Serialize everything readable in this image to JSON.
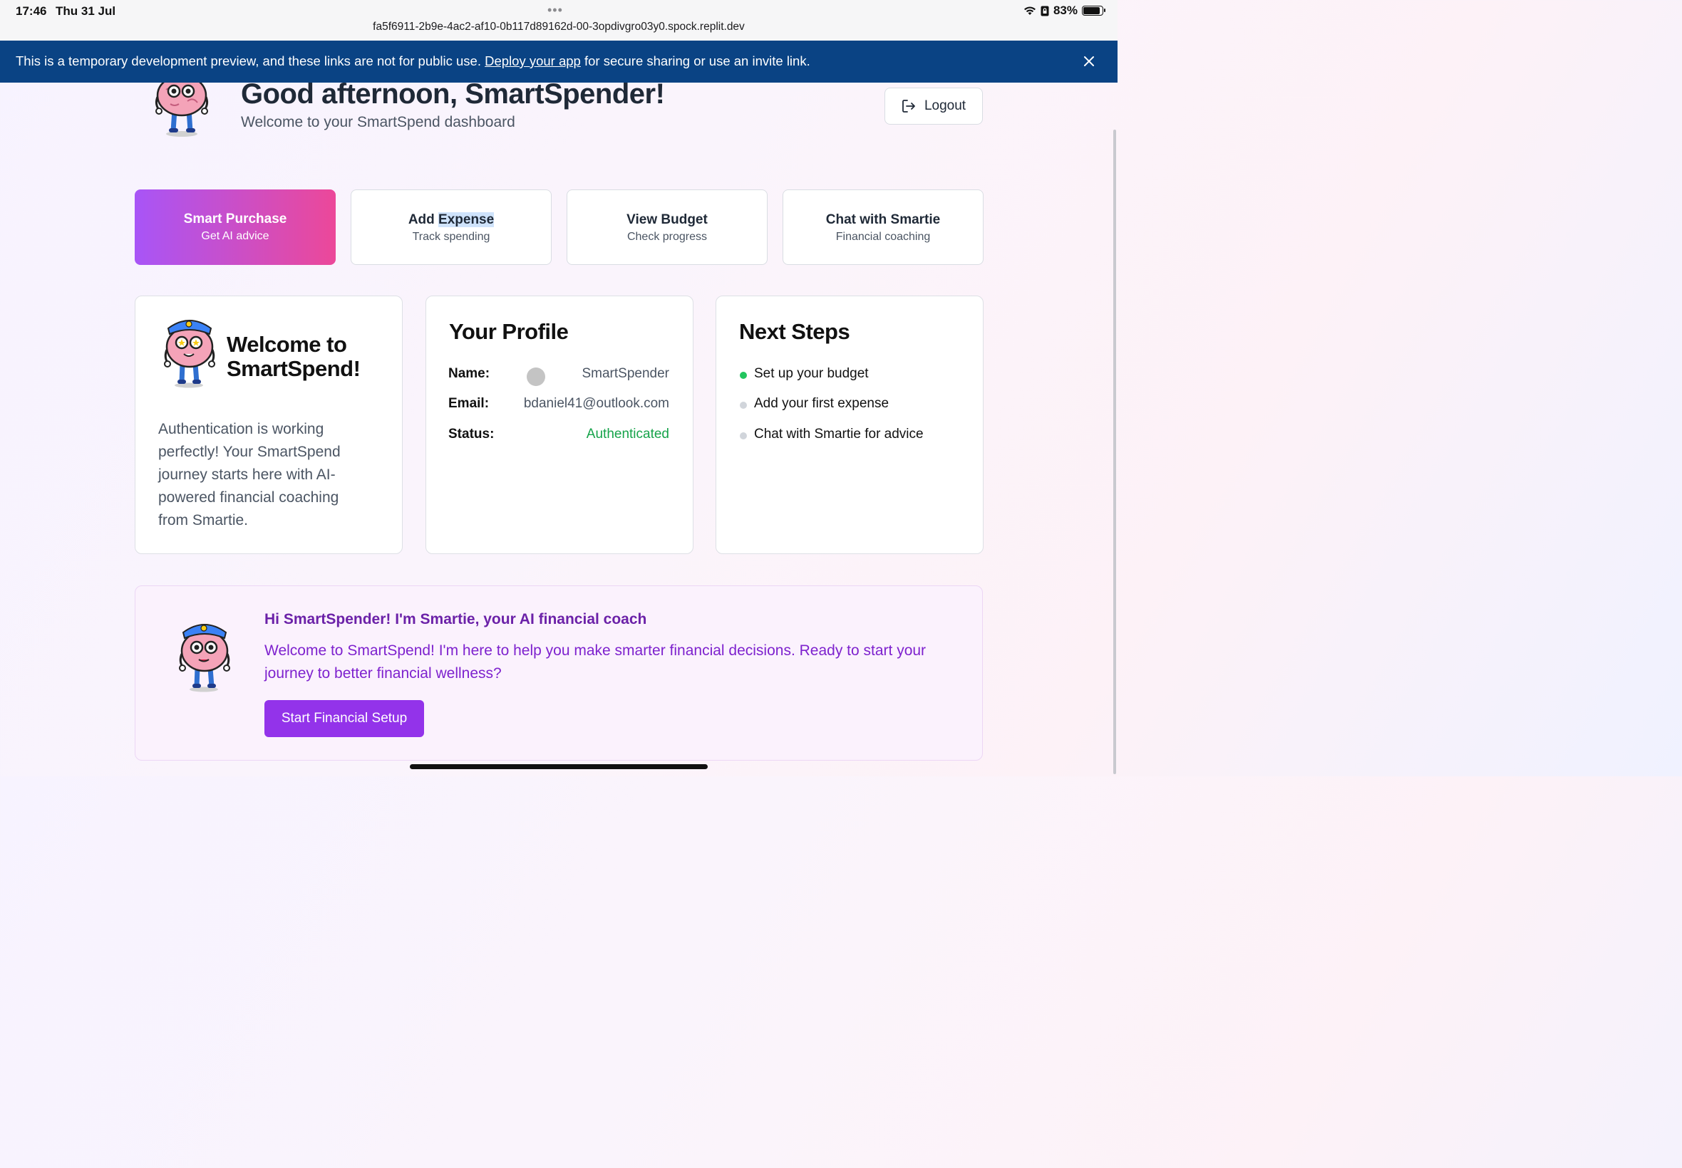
{
  "status_bar": {
    "time": "17:46",
    "date": "Thu 31 Jul",
    "url": "fa5f6911-2b9e-4ac2-af10-0b117d89162d-00-3opdivgro03y0.spock.replit.dev",
    "battery": "83%",
    "battery_level": 0.83
  },
  "banner": {
    "text_before": "This is a temporary development preview, and these links are not for public use. ",
    "link": "Deploy your app",
    "text_after": " for secure sharing or use an invite link."
  },
  "header": {
    "greeting": "Good afternoon, SmartSpender!",
    "subtitle": "Welcome to your SmartSpend dashboard",
    "logout_label": "Logout"
  },
  "actions": [
    {
      "title": "Smart Purchase",
      "subtitle": "Get AI advice"
    },
    {
      "title_part1": "Add ",
      "title_part2": "Expense",
      "subtitle": "Track spending"
    },
    {
      "title": "View Budget",
      "subtitle": "Check progress"
    },
    {
      "title": "Chat with Smartie",
      "subtitle": "Financial coaching"
    }
  ],
  "welcome_card": {
    "title_line1": "Welcome to",
    "title_line2": "SmartSpend!",
    "body": "Authentication is working perfectly! Your SmartSpend journey starts here with AI-powered financial coaching from Smartie."
  },
  "profile_card": {
    "title": "Your Profile",
    "name_label": "Name:",
    "name_value": "SmartSpender",
    "email_label": "Email:",
    "email_value": "bdaniel41@outlook.com",
    "status_label": "Status:",
    "status_value": "Authenticated"
  },
  "next_steps": {
    "title": "Next Steps",
    "items": [
      {
        "label": "Set up your budget",
        "done": true
      },
      {
        "label": "Add your first expense",
        "done": false
      },
      {
        "label": "Chat with Smartie for advice",
        "done": false
      }
    ]
  },
  "coach": {
    "title": "Hi SmartSpender! I'm Smartie, your AI financial coach",
    "text": "Welcome to SmartSpend! I'm here to help you make smarter financial decisions. Ready to start your journey to better financial wellness?",
    "button": "Start Financial Setup"
  },
  "colors": {
    "banner": "#0a4384",
    "primary_gradient_start": "#a855f7",
    "primary_gradient_end": "#ec4899",
    "authenticated": "#16a34a",
    "coach_button": "#9333ea"
  }
}
